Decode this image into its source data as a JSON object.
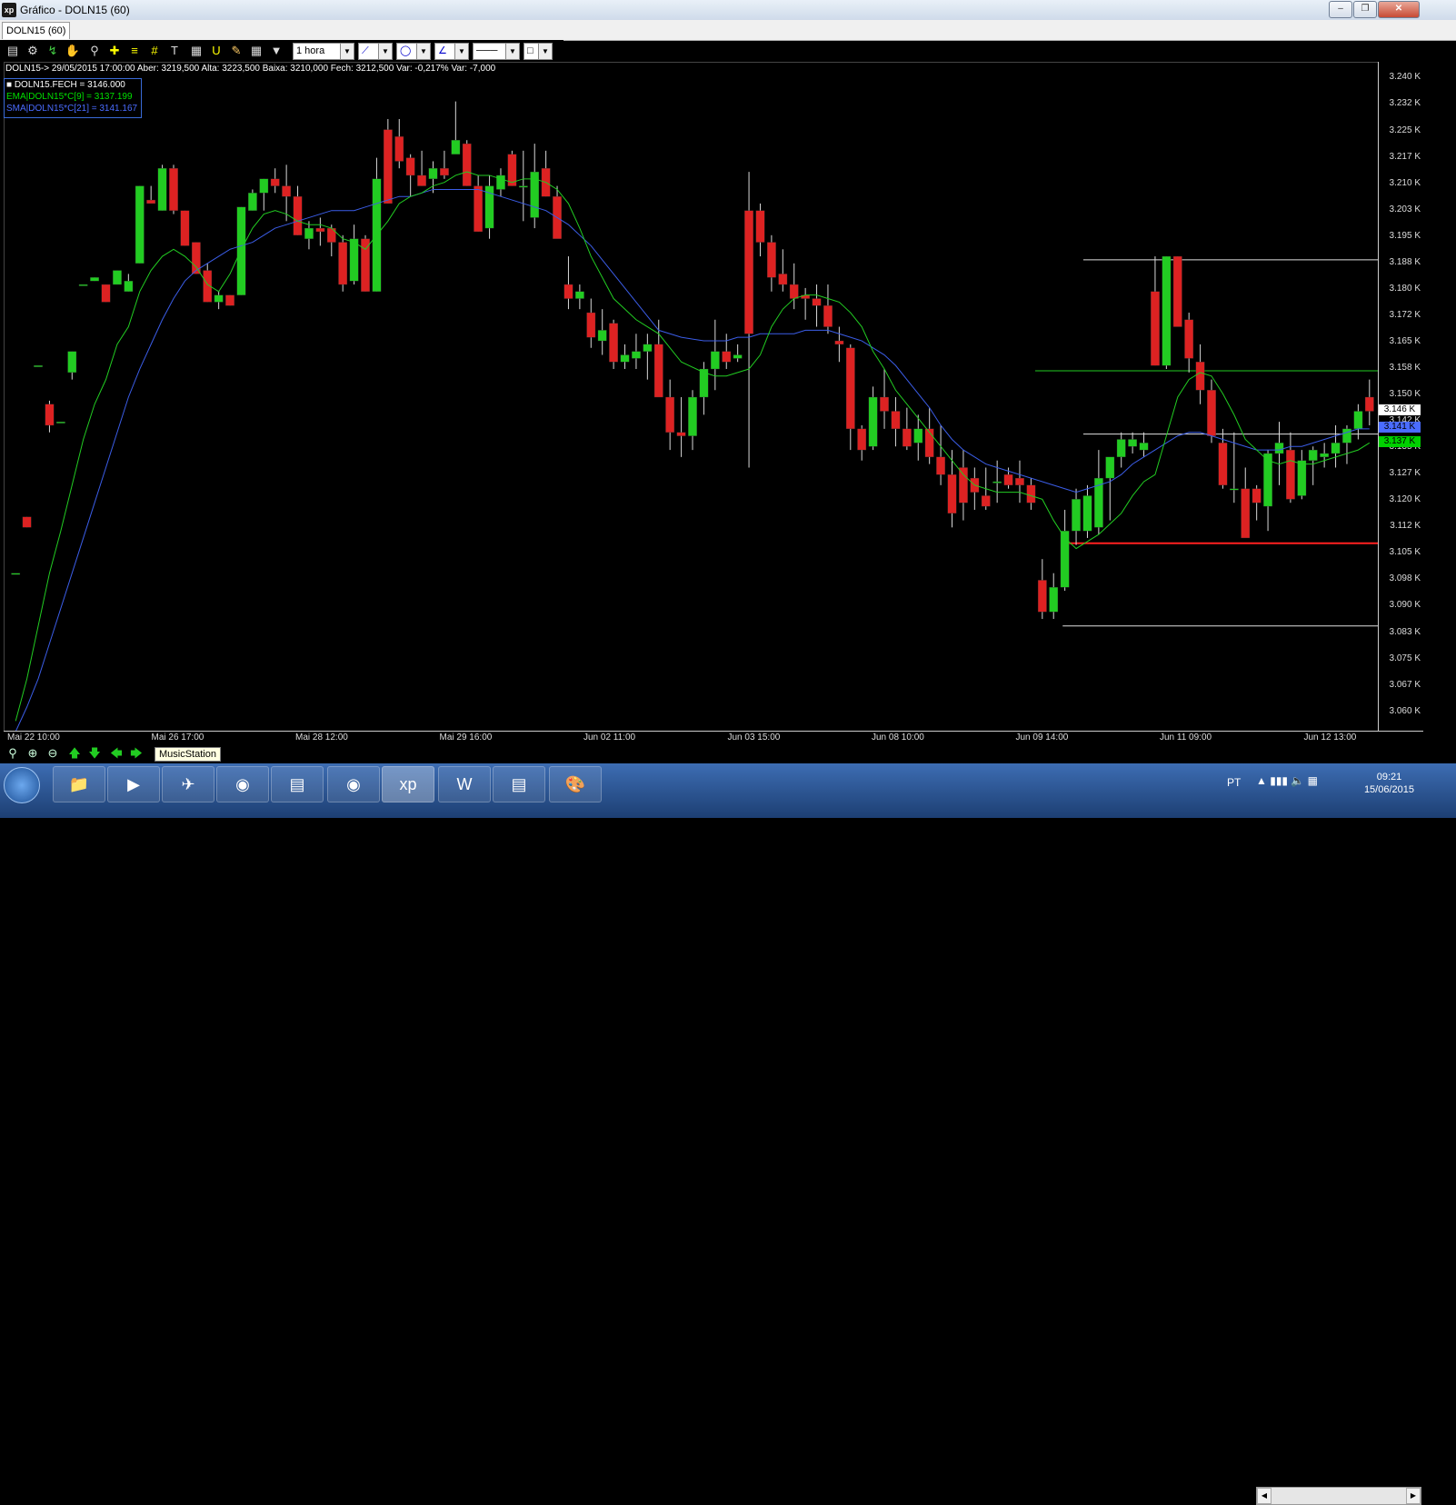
{
  "window": {
    "title": "Gráfico - DOLN15 (60)",
    "app_icon": "xp"
  },
  "tabs": [
    {
      "label": "DOLN15 (60)"
    }
  ],
  "toolbar": {
    "interval_value": "1 hora"
  },
  "info_line": "DOLN15-> 29/05/2015 17:00:00 Aber: 3219,500 Alta: 3223,500 Baixa: 3210,000 Fech: 3212,500 Var: -0,217% Var: -7,000",
  "legend": [
    {
      "text": "DOLN15.FECH = 3146.000",
      "color": "#ffffff"
    },
    {
      "text": "EMA|DOLN15*C[9] = 3137.199",
      "color": "#00e000"
    },
    {
      "text": "SMA|DOLN15*C[21] = 3141.167",
      "color": "#4a6cff"
    }
  ],
  "price_badges": [
    {
      "text": "3.146 K",
      "bg": "#ffffff",
      "price": 3146
    },
    {
      "text": "3.141 K",
      "bg": "#4a6cff",
      "price": 3141.2
    },
    {
      "text": "3.137 K",
      "bg": "#00d000",
      "price": 3137.2
    }
  ],
  "tooltip": "MusicStation",
  "tray": {
    "lang": "PT",
    "time": "09:21",
    "date": "15/06/2015"
  },
  "chart_data": {
    "type": "candlestick",
    "y_ticks": [
      "3.240 K",
      "3.232 K",
      "3.225 K",
      "3.217 K",
      "3.210 K",
      "3.203 K",
      "3.195 K",
      "3.188 K",
      "3.180 K",
      "3.172 K",
      "3.165 K",
      "3.158 K",
      "3.150 K",
      "3.142 K",
      "3.135 K",
      "3.127 K",
      "3.120 K",
      "3.112 K",
      "3.105 K",
      "3.098 K",
      "3.090 K",
      "3.083 K",
      "3.075 K",
      "3.067 K",
      "3.060 K"
    ],
    "ylim": [
      3055,
      3245
    ],
    "x_ticks": [
      "Mai 22 10:00",
      "Mai 26 17:00",
      "Mai 28 12:00",
      "Mai 29 16:00",
      "Jun 02 11:00",
      "Jun 03 15:00",
      "Jun 08 10:00",
      "Jun 09 14:00",
      "Jun 11 09:00",
      "Jun 12 13:00"
    ],
    "hlines": [
      {
        "price": 3189.0,
        "from": 0.785,
        "color": "#e0e0e0"
      },
      {
        "price": 3157.5,
        "from": 0.75,
        "color": "#22cc22"
      },
      {
        "price": 3139.5,
        "from": 0.785,
        "color": "#e0e0e0"
      },
      {
        "price": 3108.5,
        "from": 0.77,
        "color": "#ff2020",
        "width": 2
      },
      {
        "price": 3085.0,
        "from": 0.77,
        "color": "#e0e0e0"
      }
    ],
    "candles": [
      [
        3100,
        3100,
        3100,
        3100
      ],
      [
        3116,
        3113,
        3116,
        3113
      ],
      [
        3159,
        3159,
        3159,
        3159
      ],
      [
        3148,
        3149,
        3140,
        3142
      ],
      [
        3143,
        3143,
        3143,
        3143
      ],
      [
        3157,
        3163,
        3155,
        3163
      ],
      [
        3182,
        3182,
        3182,
        3182
      ],
      [
        3183,
        3184,
        3183,
        3184
      ],
      [
        3182,
        3182,
        3177,
        3177
      ],
      [
        3182,
        3186,
        3182,
        3186
      ],
      [
        3180,
        3185,
        3180,
        3183
      ],
      [
        3188,
        3210,
        3188,
        3210
      ],
      [
        3206,
        3210,
        3206,
        3205
      ],
      [
        3203,
        3216,
        3203,
        3215
      ],
      [
        3215,
        3216,
        3202,
        3203
      ],
      [
        3203,
        3203,
        3193,
        3193
      ],
      [
        3194,
        3194,
        3185,
        3185
      ],
      [
        3186,
        3188,
        3177,
        3177
      ],
      [
        3177,
        3180,
        3175,
        3179
      ],
      [
        3179,
        3179,
        3176,
        3176
      ],
      [
        3179,
        3204,
        3179,
        3204
      ],
      [
        3203,
        3209,
        3203,
        3208
      ],
      [
        3208,
        3212,
        3203,
        3212
      ],
      [
        3212,
        3215,
        3208,
        3210
      ],
      [
        3210,
        3216,
        3200,
        3207
      ],
      [
        3207,
        3210,
        3196,
        3196
      ],
      [
        3195,
        3200,
        3192,
        3198
      ],
      [
        3198,
        3201,
        3193,
        3197
      ],
      [
        3198,
        3199,
        3190,
        3194
      ],
      [
        3194,
        3196,
        3180,
        3182
      ],
      [
        3183,
        3199,
        3182,
        3195
      ],
      [
        3195,
        3196,
        3180,
        3180
      ],
      [
        3180,
        3218,
        3180,
        3212
      ],
      [
        3226,
        3229,
        3205,
        3205
      ],
      [
        3224,
        3229,
        3215,
        3217
      ],
      [
        3218,
        3219,
        3207,
        3213
      ],
      [
        3213,
        3220,
        3210,
        3210
      ],
      [
        3212,
        3217,
        3208,
        3215
      ],
      [
        3215,
        3220,
        3212,
        3213
      ],
      [
        3219,
        3234,
        3220,
        3223
      ],
      [
        3222,
        3223,
        3210,
        3210
      ],
      [
        3210,
        3213,
        3197,
        3197
      ],
      [
        3198,
        3213,
        3195,
        3210
      ],
      [
        3209,
        3215,
        3207,
        3213
      ],
      [
        3219,
        3220,
        3210,
        3210
      ],
      [
        3210,
        3220,
        3200,
        3210
      ],
      [
        3201,
        3222,
        3198,
        3214
      ],
      [
        3215,
        3220,
        3207,
        3207
      ],
      [
        3207,
        3210,
        3197,
        3195
      ],
      [
        3182,
        3190,
        3175,
        3178
      ],
      [
        3178,
        3182,
        3175,
        3180
      ],
      [
        3174,
        3178,
        3164,
        3167
      ],
      [
        3166,
        3175,
        3162,
        3169
      ],
      [
        3171,
        3172,
        3158,
        3160
      ],
      [
        3160,
        3165,
        3158,
        3162
      ],
      [
        3161,
        3168,
        3158,
        3163
      ],
      [
        3163,
        3168,
        3155,
        3165
      ],
      [
        3165,
        3172,
        3158,
        3150
      ],
      [
        3150,
        3155,
        3135,
        3140
      ],
      [
        3140,
        3150,
        3133,
        3139
      ],
      [
        3139,
        3152,
        3135,
        3150
      ],
      [
        3150,
        3160,
        3145,
        3158
      ],
      [
        3158,
        3172,
        3152,
        3163
      ],
      [
        3163,
        3168,
        3158,
        3160
      ],
      [
        3161,
        3165,
        3160,
        3162
      ],
      [
        3203,
        3214,
        3130,
        3168
      ],
      [
        3203,
        3205,
        3190,
        3194
      ],
      [
        3194,
        3196,
        3180,
        3184
      ],
      [
        3185,
        3192,
        3180,
        3182
      ],
      [
        3182,
        3188,
        3175,
        3178
      ],
      [
        3179,
        3181,
        3172,
        3178
      ],
      [
        3178,
        3182,
        3170,
        3176
      ],
      [
        3176,
        3182,
        3168,
        3170
      ],
      [
        3166,
        3170,
        3160,
        3165
      ],
      [
        3164,
        3165,
        3135,
        3141
      ],
      [
        3141,
        3142,
        3132,
        3135
      ],
      [
        3136,
        3153,
        3135,
        3150
      ],
      [
        3150,
        3158,
        3141,
        3146
      ],
      [
        3146,
        3150,
        3136,
        3141
      ],
      [
        3141,
        3147,
        3135,
        3136
      ],
      [
        3137,
        3145,
        3132,
        3141
      ],
      [
        3141,
        3147,
        3131,
        3133
      ],
      [
        3133,
        3142,
        3125,
        3128
      ],
      [
        3128,
        3135,
        3113,
        3117
      ],
      [
        3130,
        3135,
        3115,
        3120
      ],
      [
        3127,
        3130,
        3118,
        3123
      ],
      [
        3122,
        3130,
        3118,
        3119
      ],
      [
        3126,
        3132,
        3120,
        3126
      ],
      [
        3128,
        3130,
        3124,
        3125
      ],
      [
        3127,
        3132,
        3120,
        3125
      ],
      [
        3125,
        3127,
        3118,
        3120
      ],
      [
        3098,
        3104,
        3087,
        3089
      ],
      [
        3089,
        3100,
        3087,
        3096
      ],
      [
        3096,
        3118,
        3095,
        3112
      ],
      [
        3112,
        3124,
        3108,
        3121
      ],
      [
        3112,
        3125,
        3110,
        3122
      ],
      [
        3113,
        3135,
        3111,
        3127
      ],
      [
        3127,
        3132,
        3115,
        3133
      ],
      [
        3133,
        3140,
        3130,
        3138
      ],
      [
        3136,
        3140,
        3134,
        3138
      ],
      [
        3135,
        3140,
        3133,
        3137
      ],
      [
        3180,
        3190,
        3159,
        3159
      ],
      [
        3159,
        3190,
        3158,
        3190
      ],
      [
        3190,
        3190,
        3170,
        3170
      ],
      [
        3172,
        3174,
        3157,
        3161
      ],
      [
        3160,
        3165,
        3148,
        3152
      ],
      [
        3152,
        3155,
        3137,
        3139
      ],
      [
        3137,
        3141,
        3124,
        3125
      ],
      [
        3124,
        3140,
        3120,
        3124
      ],
      [
        3124,
        3130,
        3112,
        3110
      ],
      [
        3124,
        3125,
        3115,
        3120
      ],
      [
        3119,
        3135,
        3112,
        3134
      ],
      [
        3134,
        3143,
        3125,
        3137
      ],
      [
        3135,
        3140,
        3120,
        3121
      ],
      [
        3122,
        3135,
        3121,
        3132
      ],
      [
        3132,
        3136,
        3125,
        3135
      ],
      [
        3133,
        3137,
        3130,
        3134
      ],
      [
        3134,
        3142,
        3130,
        3137
      ],
      [
        3137,
        3142,
        3131,
        3141
      ],
      [
        3141,
        3148,
        3138,
        3146
      ],
      [
        3150,
        3155,
        3142,
        3146
      ]
    ],
    "ema": [
      3058,
      3070,
      3085,
      3100,
      3112,
      3125,
      3138,
      3148,
      3155,
      3165,
      3170,
      3180,
      3186,
      3190,
      3192,
      3190,
      3187,
      3182,
      3180,
      3185,
      3192,
      3198,
      3202,
      3203,
      3202,
      3200,
      3199,
      3199,
      3198,
      3195,
      3194,
      3192,
      3196,
      3200,
      3205,
      3207,
      3208,
      3210,
      3211,
      3213,
      3214,
      3213,
      3213,
      3212,
      3211,
      3212,
      3212,
      3211,
      3209,
      3205,
      3198,
      3190,
      3184,
      3178,
      3175,
      3172,
      3170,
      3168,
      3164,
      3160,
      3157,
      3156,
      3156,
      3157,
      3158,
      3162,
      3170,
      3175,
      3178,
      3179,
      3179,
      3178,
      3177,
      3174,
      3170,
      3163,
      3158,
      3152,
      3148,
      3144,
      3140,
      3136,
      3132,
      3128,
      3125,
      3124,
      3123,
      3123,
      3123,
      3122,
      3121,
      3115,
      3110,
      3107,
      3109,
      3111,
      3114,
      3117,
      3122,
      3126,
      3128,
      3139,
      3150,
      3155,
      3157,
      3156,
      3151,
      3145,
      3138,
      3135,
      3132,
      3131,
      3132,
      3131,
      3131,
      3132,
      3133,
      3134,
      3135,
      3137
    ],
    "sma": [
      3055,
      3062,
      3070,
      3080,
      3090,
      3100,
      3110,
      3120,
      3130,
      3140,
      3150,
      3158,
      3165,
      3172,
      3178,
      3183,
      3186,
      3188,
      3190,
      3192,
      3193,
      3194,
      3196,
      3198,
      3199,
      3200,
      3201,
      3202,
      3203,
      3203,
      3203,
      3204,
      3205,
      3206,
      3207,
      3207,
      3208,
      3209,
      3209,
      3209,
      3209,
      3209,
      3208,
      3207,
      3206,
      3205,
      3204,
      3203,
      3201,
      3199,
      3196,
      3193,
      3189,
      3185,
      3181,
      3177,
      3173,
      3169,
      3168,
      3167,
      3166,
      3166,
      3166,
      3167,
      3167,
      3168,
      3168,
      3168,
      3168,
      3169,
      3169,
      3169,
      3168,
      3167,
      3166,
      3164,
      3162,
      3159,
      3155,
      3151,
      3147,
      3142,
      3138,
      3135,
      3133,
      3131,
      3130,
      3129,
      3128,
      3127,
      3126,
      3125,
      3124,
      3123,
      3124,
      3125,
      3126,
      3128,
      3131,
      3133,
      3135,
      3137,
      3139,
      3140,
      3140,
      3139,
      3138,
      3137,
      3136,
      3135,
      3135,
      3135,
      3136,
      3136,
      3137,
      3138,
      3139,
      3140,
      3141,
      3141
    ]
  }
}
